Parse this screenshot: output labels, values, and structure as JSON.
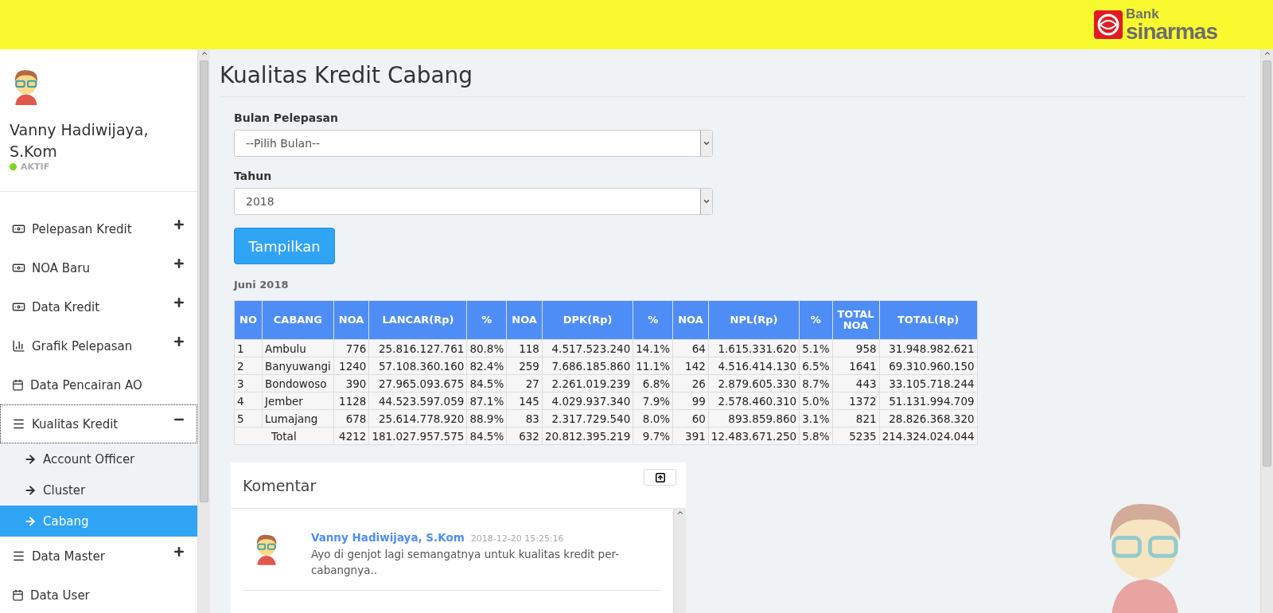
{
  "header": {
    "logo_top": "Bank",
    "logo_bottom": "sinarmas"
  },
  "user": {
    "name": "Vanny Hadiwijaya, S.Kom",
    "status": "AKTIF",
    "online": true
  },
  "sidebar": {
    "items": [
      {
        "label": "Pelepasan Kredit",
        "kind": "group",
        "expanded": false,
        "focused": false
      },
      {
        "label": "NOA Baru",
        "kind": "group",
        "expanded": false,
        "focused": false
      },
      {
        "label": "Data Kredit",
        "kind": "group",
        "expanded": false,
        "focused": false
      },
      {
        "label": "Grafik Pelepasan",
        "kind": "group",
        "expanded": false,
        "focused": false
      },
      {
        "label": "Data Pencairan AO",
        "kind": "link",
        "focused": false
      },
      {
        "label": "Kualitas Kredit",
        "kind": "group",
        "expanded": true,
        "focused": true,
        "children": [
          {
            "label": "Account Officer",
            "selected": false
          },
          {
            "label": "Cluster",
            "selected": false
          },
          {
            "label": "Cabang",
            "selected": true
          }
        ]
      },
      {
        "label": "Data Master",
        "kind": "group",
        "expanded": false,
        "focused": false
      },
      {
        "label": "Data User",
        "kind": "link",
        "focused": false
      }
    ]
  },
  "page_title": "Kualitas Kredit Cabang",
  "form": {
    "fields": [
      {
        "label": "Bulan Pelepasan",
        "value": "--Pilih Bulan--"
      },
      {
        "label": "Tahun",
        "value": "2018"
      }
    ],
    "button": "Tampilkan"
  },
  "period": "Juni  2018",
  "table": {
    "columns": [
      "NO",
      "CABANG",
      "NOA",
      "LANCAR(Rp)",
      "%",
      "NOA",
      "DPK(Rp)",
      "%",
      "NOA",
      "NPL(Rp)",
      "%",
      "TOTAL NOA",
      "TOTAL(Rp)"
    ],
    "rows": [
      [
        "1",
        "Ambulu",
        "776",
        "25.816.127.761",
        "80.8%",
        "118",
        "4.517.523.240",
        "14.1%",
        "64",
        "1.615.331.620",
        "5.1%",
        "958",
        "31.948.982.621"
      ],
      [
        "2",
        "Banyuwangi",
        "1240",
        "57.108.360.160",
        "82.4%",
        "259",
        "7.686.185.860",
        "11.1%",
        "142",
        "4.516.414.130",
        "6.5%",
        "1641",
        "69.310.960.150"
      ],
      [
        "3",
        "Bondowoso",
        "390",
        "27.965.093.675",
        "84.5%",
        "27",
        "2.261.019.239",
        "6.8%",
        "26",
        "2.879.605.330",
        "8.7%",
        "443",
        "33.105.718.244"
      ],
      [
        "4",
        "Jember",
        "1128",
        "44.523.597.059",
        "87.1%",
        "145",
        "4.029.937.340",
        "7.9%",
        "99",
        "2.578.460.310",
        "5.0%",
        "1372",
        "51.131.994.709"
      ],
      [
        "5",
        "Lumajang",
        "678",
        "25.614.778.920",
        "88.9%",
        "83",
        "2.317.729.540",
        "8.0%",
        "60",
        "893.859.860",
        "3.1%",
        "821",
        "28.826.368.320"
      ]
    ],
    "total": [
      "Total",
      "4212",
      "181.027.957.575",
      "84.5%",
      "632",
      "20.812.395.219",
      "9.7%",
      "391",
      "12.483.671.250",
      "5.8%",
      "5235",
      "214.324.024.044"
    ]
  },
  "comments": {
    "title": "Komentar",
    "items": [
      {
        "author": "Vanny Hadiwijaya, S.Kom",
        "time": "2018-12-20 15:25:16",
        "text": "Ayo di genjot lagi semangatnya untuk kualitas kredit per-cabangnya.."
      }
    ]
  }
}
